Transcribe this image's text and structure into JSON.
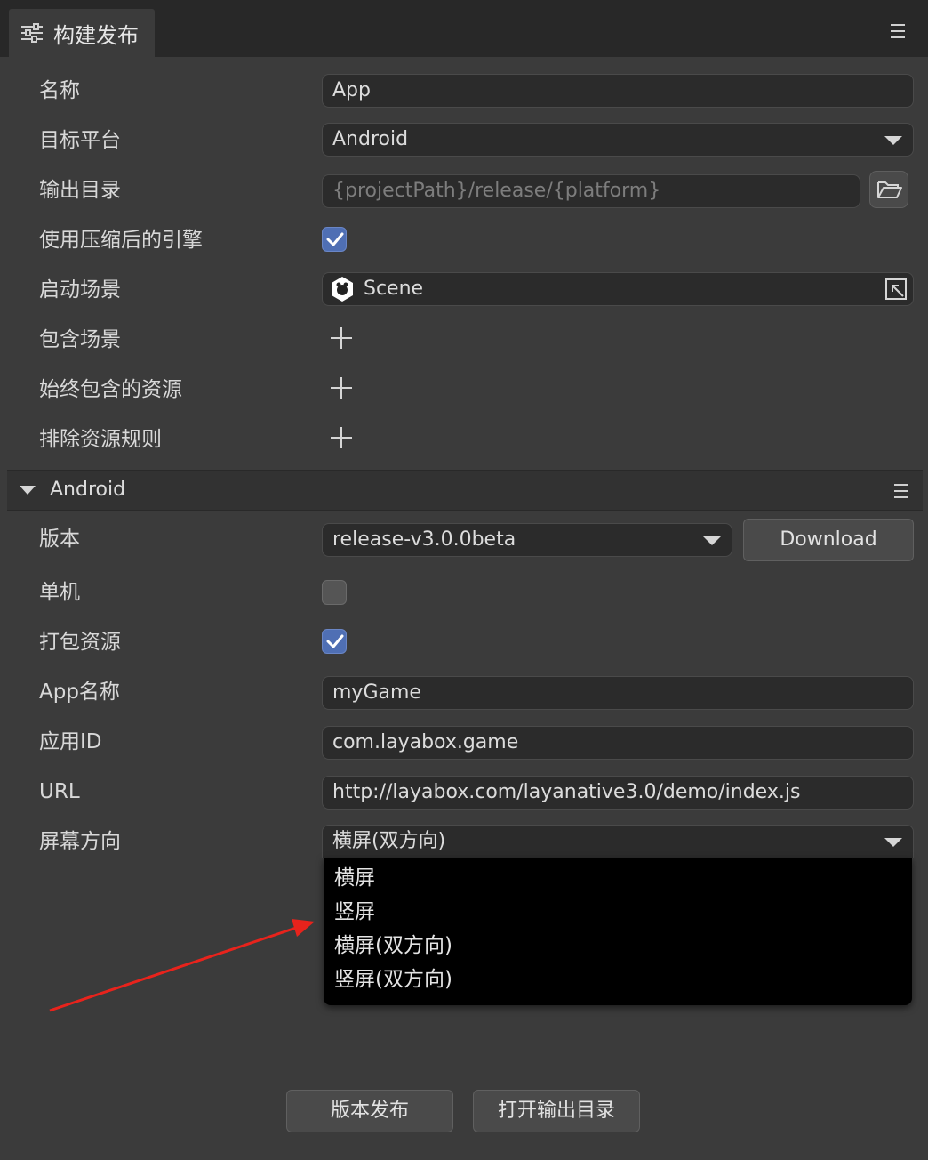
{
  "header": {
    "tab_title": "构建发布"
  },
  "general": {
    "name_label": "名称",
    "name_value": "App",
    "platform_label": "目标平台",
    "platform_value": "Android",
    "output_label": "输出目录",
    "output_placeholder": "{projectPath}/release/{platform}",
    "compressed_label": "使用压缩后的引擎",
    "compressed_checked": true,
    "start_scene_label": "启动场景",
    "start_scene_value": "Scene",
    "include_scenes_label": "包含场景",
    "always_include_label": "始终包含的资源",
    "exclude_rules_label": "排除资源规则"
  },
  "android": {
    "section_title": "Android",
    "version_label": "版本",
    "version_value": "release-v3.0.0beta",
    "download_label": "Download",
    "standalone_label": "单机",
    "standalone_checked": false,
    "pack_label": "打包资源",
    "pack_checked": true,
    "app_name_label": "App名称",
    "app_name_value": "myGame",
    "app_id_label": "应用ID",
    "app_id_value": "com.layabox.game",
    "url_label": "URL",
    "url_value": "http://layabox.com/layanative3.0/demo/index.js",
    "orientation_label": "屏幕方向",
    "orientation_value": "横屏(双方向)",
    "orientation_options": [
      "横屏",
      "竖屏",
      "横屏(双方向)",
      "竖屏(双方向)"
    ]
  },
  "footer": {
    "publish_label": "版本发布",
    "open_output_label": "打开输出目录"
  },
  "colors": {
    "panel_bg": "#3b3b3b",
    "checkbox_on": "#4f6fb4",
    "annotation_arrow": "#e8231c"
  }
}
